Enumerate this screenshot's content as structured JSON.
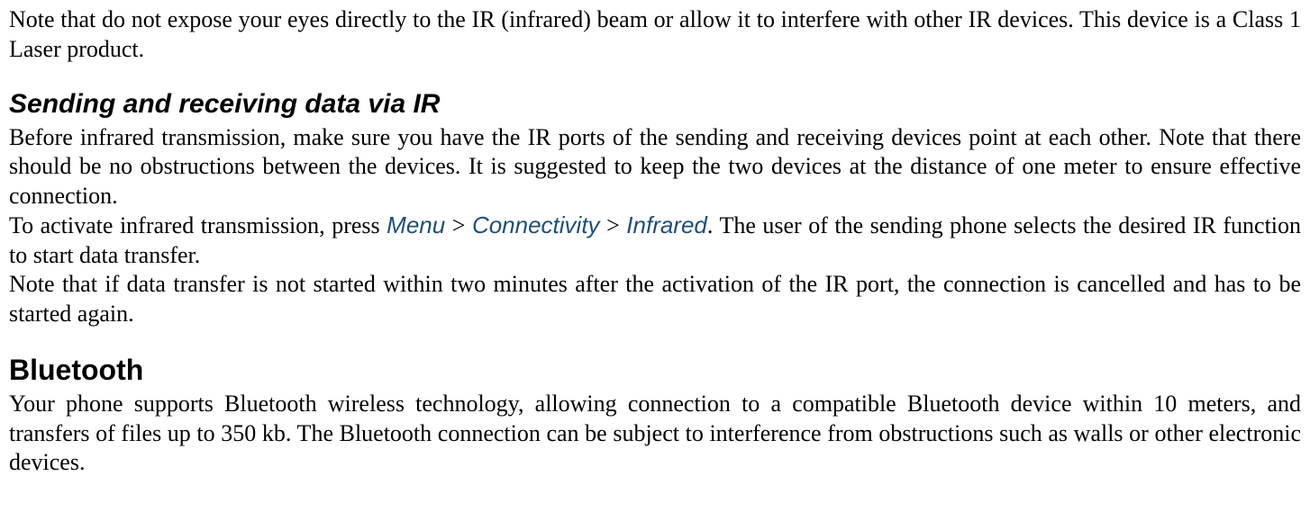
{
  "intro": {
    "p1": "Note that do not expose your eyes directly to the IR (infrared) beam or allow it to interfere with other IR devices. This device is a Class 1 Laser product."
  },
  "section_ir": {
    "heading": "Sending and receiving data via IR",
    "p1": "Before infrared transmission, make sure you have the IR ports of the sending and receiving devices point at each other. Note that there should be no obstructions between the devices. It is suggested to keep the two devices at the distance of one meter to ensure effective connection.",
    "p2_pre": "To activate infrared transmission, press ",
    "p2_menu1": "Menu",
    "p2_sep1": " > ",
    "p2_menu2": "Connectivity",
    "p2_sep2": " > ",
    "p2_menu3": "Infrared",
    "p2_post": ". The user of the sending phone selects the desired IR function to start data transfer.",
    "p3": "Note that if data transfer is not started within two minutes after the activation of the IR port, the connection is cancelled and has to be started again."
  },
  "section_bt": {
    "heading": "Bluetooth",
    "p1": "Your phone supports Bluetooth wireless technology, allowing connection to a compatible Bluetooth device within 10 meters, and transfers of files up to 350 kb. The Bluetooth connection can be subject to interference from obstructions such as walls or other electronic devices."
  }
}
